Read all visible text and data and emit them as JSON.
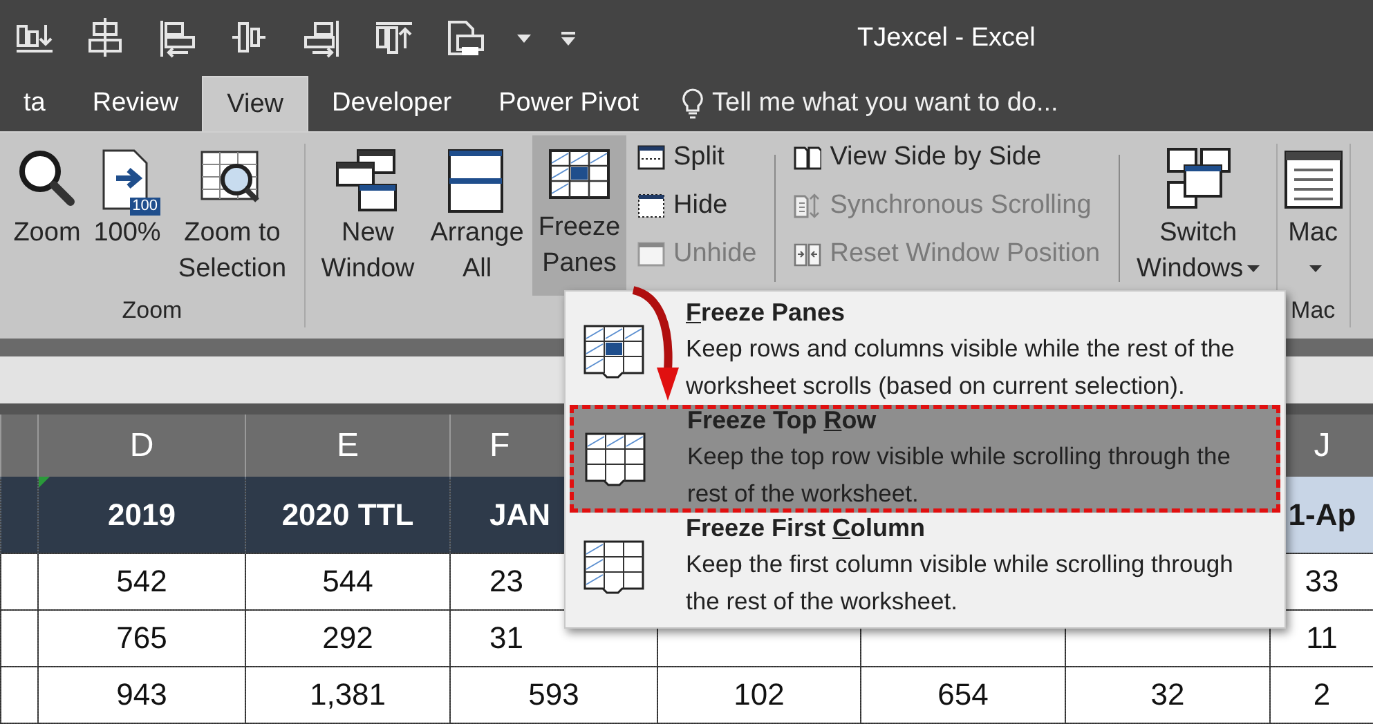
{
  "window": {
    "title": "TJexcel - Excel"
  },
  "tabs": [
    {
      "label": "ta",
      "selected": false
    },
    {
      "label": "Review",
      "selected": false
    },
    {
      "label": "View",
      "selected": true
    },
    {
      "label": "Developer",
      "selected": false
    },
    {
      "label": "Power Pivot",
      "selected": false
    }
  ],
  "tell_me": {
    "placeholder": "Tell me what you want to do..."
  },
  "ribbon": {
    "groups": [
      {
        "label": "Zoom",
        "controls": [
          {
            "kind": "large",
            "label": "Zoom"
          },
          {
            "kind": "large",
            "label": "100%",
            "badge": "100"
          },
          {
            "kind": "large",
            "label": "Zoom to Selection"
          }
        ]
      },
      {
        "controls": [
          {
            "kind": "large",
            "label": "New Window"
          },
          {
            "kind": "large",
            "label": "Arrange All"
          },
          {
            "kind": "large",
            "label": "Freeze Panes",
            "dropdown": true,
            "expanded": true
          },
          {
            "kind": "stack",
            "items": [
              {
                "label": "Split",
                "disabled": false
              },
              {
                "label": "Hide",
                "disabled": false
              },
              {
                "label": "Unhide",
                "disabled": true
              }
            ]
          },
          {
            "kind": "stack",
            "separator_before": true,
            "items": [
              {
                "label": "View Side by Side",
                "disabled": false
              },
              {
                "label": "Synchronous Scrolling",
                "disabled": true
              },
              {
                "label": "Reset Window Position",
                "disabled": true
              }
            ]
          },
          {
            "kind": "large",
            "separator_before": true,
            "label": "Switch Windows",
            "dropdown": true,
            "expanded": false
          }
        ]
      },
      {
        "label": "Mac",
        "controls": [
          {
            "kind": "large",
            "label": "Mac",
            "dropdown": true,
            "expanded": false
          }
        ]
      }
    ]
  },
  "sheet": {
    "columns": [
      {
        "letter": "D",
        "title": "2019"
      },
      {
        "letter": "E",
        "title": "2020 TTL"
      },
      {
        "letter": "F",
        "title": "JAN"
      },
      {},
      {},
      {},
      {
        "letter": "J",
        "title": "1-Ap",
        "highlighted": true
      }
    ],
    "rows": [
      [
        "542",
        "544",
        "23",
        null,
        null,
        null,
        "33"
      ],
      [
        "765",
        "292",
        "31",
        null,
        null,
        null,
        "11"
      ],
      [
        "943",
        "1,381",
        "593",
        "102",
        "654",
        "32",
        "2"
      ]
    ]
  },
  "freeze_menu": {
    "items": [
      {
        "access_key": "F",
        "label_after": "reeze Panes",
        "description": "Keep rows and columns visible while the rest of the worksheet scrolls (based on current selection).",
        "selected": false
      },
      {
        "label_before": "Freeze Top ",
        "access_key": "R",
        "label_after": "ow",
        "description": "Keep the top row visible while scrolling through the rest of the worksheet.",
        "selected": true
      },
      {
        "label_before": "Freeze First ",
        "access_key": "C",
        "label_after": "olumn",
        "description": "Keep the first column visible while scrolling through the rest of the worksheet.",
        "selected": false
      }
    ]
  }
}
